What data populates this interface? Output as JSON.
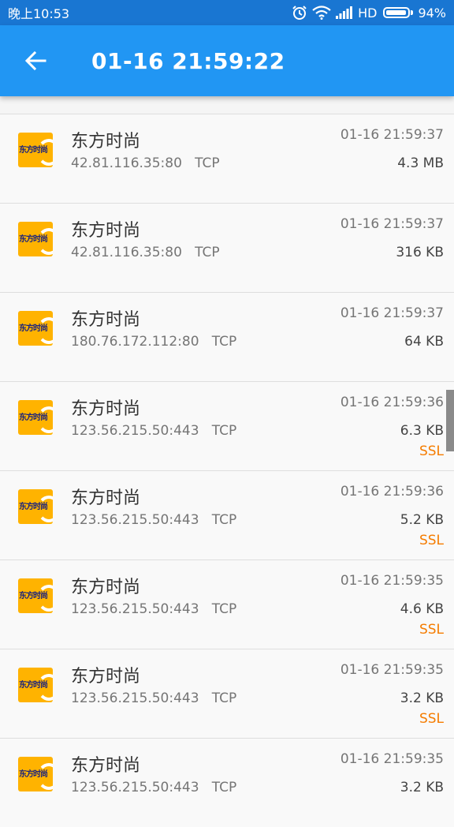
{
  "status_bar": {
    "time": "晚上10:53",
    "network": "HD",
    "battery": "94%"
  },
  "app_bar": {
    "title": "01-16 21:59:22"
  },
  "connections": [
    {
      "name": "东方时尚",
      "address": "42.81.116.35:80",
      "protocol": "TCP",
      "time": "01-16 21:59:37",
      "size": "4.3 MB",
      "ssl": ""
    },
    {
      "name": "东方时尚",
      "address": "42.81.116.35:80",
      "protocol": "TCP",
      "time": "01-16 21:59:37",
      "size": "316 KB",
      "ssl": ""
    },
    {
      "name": "东方时尚",
      "address": "180.76.172.112:80",
      "protocol": "TCP",
      "time": "01-16 21:59:37",
      "size": "64 KB",
      "ssl": ""
    },
    {
      "name": "东方时尚",
      "address": "123.56.215.50:443",
      "protocol": "TCP",
      "time": "01-16 21:59:36",
      "size": "6.3 KB",
      "ssl": "SSL"
    },
    {
      "name": "东方时尚",
      "address": "123.56.215.50:443",
      "protocol": "TCP",
      "time": "01-16 21:59:36",
      "size": "5.2 KB",
      "ssl": "SSL"
    },
    {
      "name": "东方时尚",
      "address": "123.56.215.50:443",
      "protocol": "TCP",
      "time": "01-16 21:59:35",
      "size": "4.6 KB",
      "ssl": "SSL"
    },
    {
      "name": "东方时尚",
      "address": "123.56.215.50:443",
      "protocol": "TCP",
      "time": "01-16 21:59:35",
      "size": "3.2 KB",
      "ssl": "SSL"
    },
    {
      "name": "东方时尚",
      "address": "123.56.215.50:443",
      "protocol": "TCP",
      "time": "01-16 21:59:35",
      "size": "3.2 KB",
      "ssl": ""
    }
  ],
  "icons": {
    "app_logo_text": "东方时尚",
    "back": "back-arrow-icon"
  },
  "colors": {
    "status_bar": "#1976d2",
    "app_bar": "#2196f3",
    "ssl": "#f57c00"
  }
}
